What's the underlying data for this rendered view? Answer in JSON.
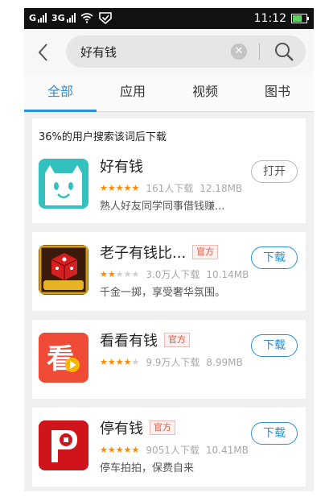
{
  "status_bar": {
    "sim1_label": "G",
    "sim2_label": "3G",
    "time": "11:12"
  },
  "search": {
    "query": "好有钱",
    "clear_icon": "clear-icon",
    "search_icon": "magnifier-icon"
  },
  "tabs": [
    {
      "label": "全部",
      "active": true
    },
    {
      "label": "应用",
      "active": false
    },
    {
      "label": "视频",
      "active": false
    },
    {
      "label": "图书",
      "active": false
    }
  ],
  "hint": "36%的用户搜索该词后下载",
  "apps": [
    {
      "name": "好有钱",
      "badge": "",
      "rating_stars": 5,
      "downloads": "161人下载",
      "size": "12.18MB",
      "desc": "熟人好友同学同事借钱赚...",
      "action": "打开",
      "icon": "smiling-cat-icon"
    },
    {
      "name": "老子有钱比...",
      "badge": "官方",
      "rating_stars": 2,
      "downloads": "3.0万人下载",
      "size": "10.14MB",
      "desc": "千金一掷，享受奢华氛围。",
      "action": "下载",
      "icon": "dice-game-icon"
    },
    {
      "name": "看看有钱",
      "badge": "官方",
      "rating_stars": 4,
      "downloads": "9.9万人下载",
      "size": "8.99MB",
      "desc": "",
      "action": "下载",
      "icon": "kan-video-icon"
    },
    {
      "name": "停有钱",
      "badge": "官方",
      "rating_stars": 5,
      "downloads": "9051人下载",
      "size": "10.41MB",
      "desc": "停车拍拍，保费自来",
      "action": "下载",
      "icon": "parking-coin-icon"
    }
  ]
}
